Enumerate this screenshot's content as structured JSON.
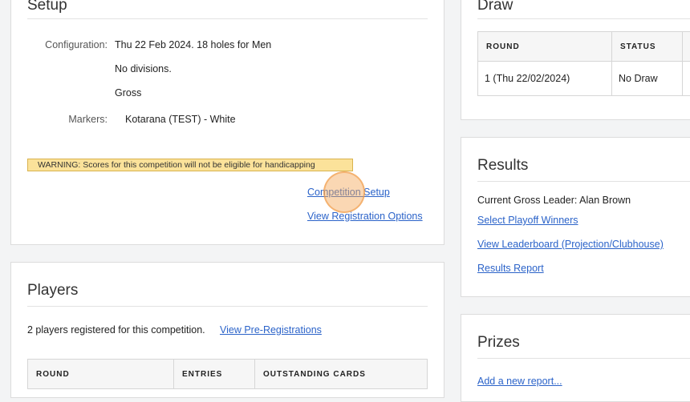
{
  "setup": {
    "title": "Setup",
    "configuration_label": "Configuration:",
    "configuration_lines": [
      "Thu 22 Feb 2024. 18 holes for Men",
      "No divisions.",
      "Gross"
    ],
    "markers_label": "Markers:",
    "markers_value": "Kotarana (TEST) - White",
    "warning": "WARNING: Scores for this competition will not be eligible for handicapping",
    "competition_setup_link": "Competition Setup",
    "registration_options_link": "View Registration Options"
  },
  "players": {
    "title": "Players",
    "summary": "2 players registered for this competition.",
    "pre_registrations_link": "View Pre-Registrations",
    "columns": [
      "ROUND",
      "ENTRIES",
      "OUTSTANDING CARDS"
    ]
  },
  "draw": {
    "title": "Draw",
    "columns": [
      "ROUND",
      "STATUS"
    ],
    "rows": [
      {
        "round": "1 (Thu 22/02/2024)",
        "status": "No Draw"
      }
    ]
  },
  "results": {
    "title": "Results",
    "leader": "Current Gross Leader: Alan Brown",
    "links": [
      "Select Playoff Winners",
      "View Leaderboard (Projection/Clubhouse)",
      "Results Report"
    ]
  },
  "prizes": {
    "title": "Prizes",
    "add_report_link": "Add a new report..."
  }
}
